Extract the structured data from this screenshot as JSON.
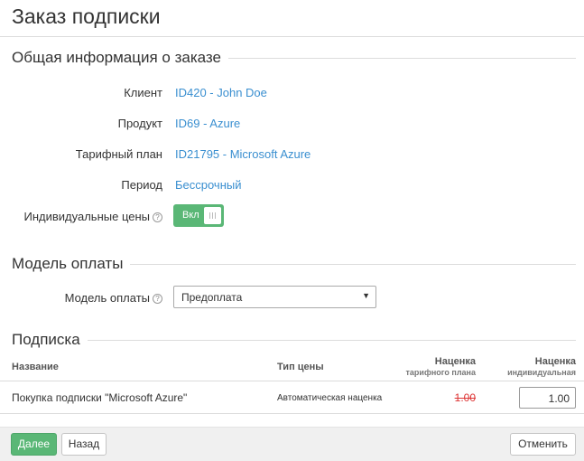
{
  "page": {
    "title": "Заказ подписки"
  },
  "general": {
    "heading": "Общая информация о заказе",
    "client_label": "Клиент",
    "client_value": "ID420 - John Doe",
    "product_label": "Продукт",
    "product_value": "ID69 - Azure",
    "plan_label": "Тарифный план",
    "plan_value": "ID21795 - Microsoft Azure",
    "period_label": "Период",
    "period_value": "Бессрочный",
    "custom_prices_label": "Индивидуальные цены",
    "custom_prices_toggle": "Вкл",
    "custom_prices_on": true
  },
  "payment": {
    "heading": "Модель оплаты",
    "model_label": "Модель оплаты",
    "model_value": "Предоплата"
  },
  "subscription": {
    "heading": "Подписка",
    "columns": {
      "name": "Название",
      "price_type": "Тип цены",
      "plan_markup": "Наценка",
      "plan_markup_sub": "тарифного плана",
      "custom_markup": "Наценка",
      "custom_markup_sub": "индивидуальная"
    },
    "rows": [
      {
        "name": "Покупка подписки \"Microsoft Azure\"",
        "price_type": "Автоматическая наценка",
        "plan_markup": "1.00",
        "custom_markup": "1.00"
      }
    ]
  },
  "footer": {
    "next": "Далее",
    "back": "Назад",
    "cancel": "Отменить"
  },
  "colors": {
    "accent_green": "#5ab776",
    "link_blue": "#3a8fd0",
    "strike_red": "#dd3333"
  }
}
